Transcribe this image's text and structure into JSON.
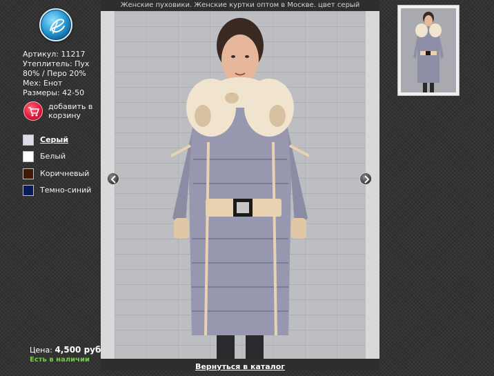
{
  "product": {
    "title": "Женские пуховики. Женские куртки оптом в Москве. цвет серый",
    "sku": "Артикул: 11217",
    "filling": "Утеплитель: Пух 80% / Перо 20%",
    "fur": "Мех: Енот",
    "sizes": "Размеры: 42-50"
  },
  "cart": {
    "label": "добавить в корзину",
    "icon": "shopping-cart-icon"
  },
  "colors": [
    {
      "label": "Серый",
      "hex": "#dcdce8",
      "active": true
    },
    {
      "label": "Белый",
      "hex": "#ffffff",
      "active": false
    },
    {
      "label": "Коричневый",
      "hex": "#3d1a05",
      "active": false
    },
    {
      "label": "Темно-синий",
      "hex": "#0a1a5a",
      "active": false
    }
  ],
  "price": {
    "label": "Цена:",
    "value": "4,500 руб."
  },
  "stock": {
    "label": "Есть в наличии",
    "color": "#6fd13a"
  },
  "viewer": {
    "back_link": "Вернуться в каталог",
    "prev_icon": "chevron-left-icon",
    "next_icon": "chevron-right-icon"
  },
  "logo": {
    "icon": "brand-logo-icon"
  }
}
